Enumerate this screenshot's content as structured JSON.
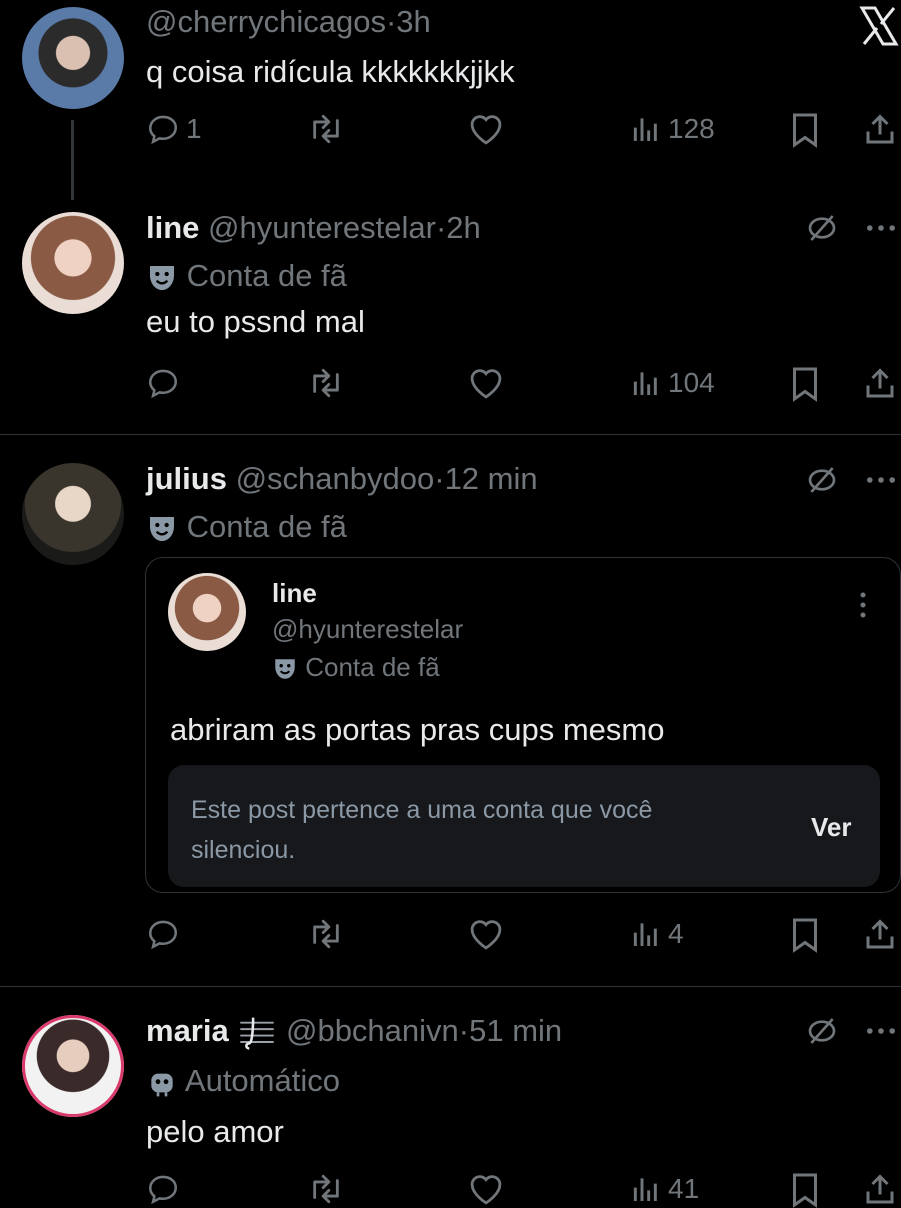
{
  "colors": {
    "background": "#000000",
    "text": "#e7e9ea",
    "muted": "#71767b",
    "divider": "#2f3336"
  },
  "header_icon": "x-logo-icon",
  "posts": [
    {
      "handle": "@cherrychicagos",
      "time": "3h",
      "text": "q coisa ridícula kkkkkkkjjkk",
      "replies": "1",
      "views": "128"
    },
    {
      "name": "line",
      "handle": "@hyunterestelar",
      "time": "2h",
      "label": "Conta de fã",
      "text": "eu to pssnd mal",
      "views": "104"
    },
    {
      "name": "julius",
      "handle": "@schanbydoo",
      "time": "12 min",
      "label": "Conta de fã",
      "views": "4",
      "quote": {
        "name": "line",
        "handle": "@hyunterestelar",
        "label": "Conta de fã",
        "text": "abriram as portas pras cups mesmo",
        "muted_notice": "Este post pertence a uma conta que você silenciou.",
        "muted_notice_line1": "Este post pertence a uma conta que você",
        "muted_notice_line2": "silenciou.",
        "view_label": "Ver"
      }
    },
    {
      "name": "maria",
      "handle": "@bbchanivn",
      "time": "51 min",
      "label": "Automático",
      "text": "pelo amor",
      "views": "41"
    }
  ],
  "separator": "·"
}
